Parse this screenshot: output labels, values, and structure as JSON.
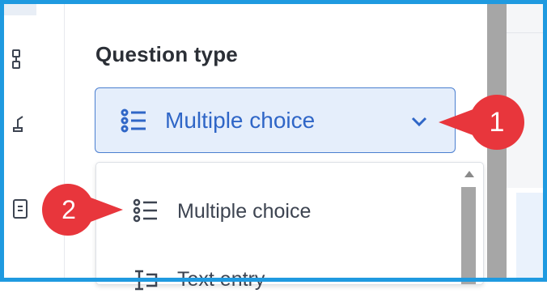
{
  "panel": {
    "title": "Question type",
    "select": {
      "value": "Multiple choice",
      "icon": "list-icon"
    }
  },
  "dropdown": {
    "options": [
      {
        "label": "Multiple choice",
        "icon": "list-icon"
      },
      {
        "label": "Text entry",
        "icon": "text-entry-icon"
      }
    ]
  },
  "callouts": [
    {
      "number": "1",
      "color": "#e8363c"
    },
    {
      "number": "2",
      "color": "#e8363c"
    }
  ],
  "colors": {
    "accent": "#2f66c7",
    "select_bg": "#e5eefb",
    "frame": "#1f9ae0",
    "callout": "#e8363c"
  }
}
